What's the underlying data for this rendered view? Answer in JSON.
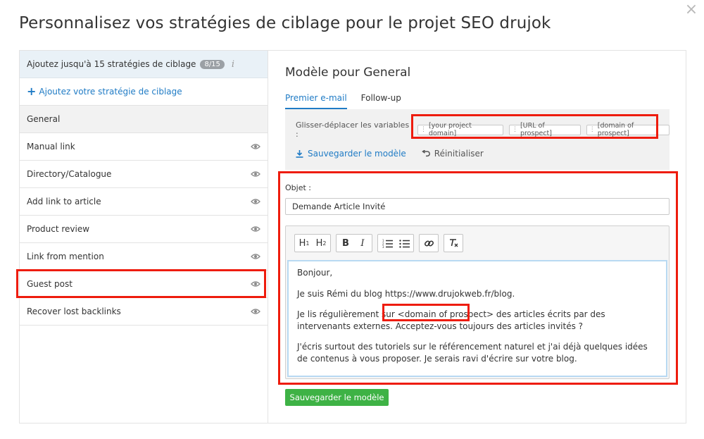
{
  "modal": {
    "title": "Personnalisez vos stratégies de ciblage pour le projet SEO drujok",
    "close_symbol": "×"
  },
  "sidebar": {
    "limit_text": "Ajoutez jusqu'à 15 stratégies de ciblage",
    "limit_badge": "8/15",
    "info_symbol": "i",
    "add_label": "Ajoutez votre stratégie de ciblage",
    "items": [
      {
        "label": "General",
        "active": true
      },
      {
        "label": "Manual link"
      },
      {
        "label": "Directory/Catalogue"
      },
      {
        "label": "Add link to article"
      },
      {
        "label": "Product review"
      },
      {
        "label": "Link from mention"
      },
      {
        "label": "Guest post"
      },
      {
        "label": "Recover lost backlinks"
      }
    ]
  },
  "main": {
    "title": "Modèle pour General",
    "tabs": [
      {
        "label": "Premier e-mail",
        "active": true
      },
      {
        "label": "Follow-up"
      }
    ],
    "variables": {
      "label": "Glisser-déplacer les variables :",
      "chips": [
        "[your project domain]",
        "[URL of prospect]",
        "[domain of prospect]"
      ]
    },
    "save_template_link": "Sauvegarder le modèle",
    "reset_link": "Réinitialiser",
    "subject_label": "Objet :",
    "subject_value": "Demande Article Invité",
    "toolbar": {
      "h1": "H",
      "h1_sub": "1",
      "h2": "H",
      "h2_sub": "2",
      "bold": "B",
      "italic": "I"
    },
    "body": {
      "p1": "Bonjour,",
      "p2": "Je suis Rémi du blog https://www.drujokweb.fr/blog.",
      "p3_before": "Je lis régulièrement sur ",
      "p3_token": "<domain of prospect>",
      "p3_after": " des articles écrits par des intervenants externes. Acceptez-vous toujours des articles invités ?",
      "p4": "J'écris surtout des tutoriels sur le référencement naturel et j'ai déjà quelques idées de contenus à vous proposer. Je serais ravi d'écrire sur votre blog."
    },
    "save_button": "Sauvegarder le modèle"
  },
  "colors": {
    "accent": "#1f7bc5",
    "save_green": "#3eb245",
    "highlight_red": "#ee1c0d"
  }
}
